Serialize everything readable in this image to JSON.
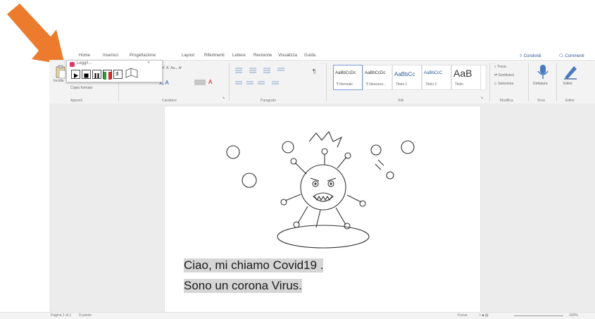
{
  "tabs": [
    {
      "label": "Home"
    },
    {
      "label": "Inserisci"
    },
    {
      "label": "Progettazione"
    },
    {
      "label": "Layout"
    },
    {
      "label": "Riferimenti"
    },
    {
      "label": "Lettere"
    },
    {
      "label": "Revisione"
    },
    {
      "label": "Visualizza"
    },
    {
      "label": "Guida"
    }
  ],
  "share_label": "Condividi",
  "comments_label": "Commenti",
  "clipboard": {
    "paste_label": "Incolla",
    "copy_format_label": "Copia formato",
    "group_label": "Appunti"
  },
  "font": {
    "size_controls": "Aˆ Aˇ  Aa⌄  A̸",
    "group_label": "Carattere"
  },
  "paragraph": {
    "group_label": "Paragrafo"
  },
  "styles": {
    "items": [
      {
        "preview": "AaBbCcDc",
        "name": "¶ Normale"
      },
      {
        "preview": "AaBbCcDc",
        "name": "¶ Nessuna..."
      },
      {
        "preview": "AaBbCc",
        "name": "Titolo 1"
      },
      {
        "preview": "AaBbCcC",
        "name": "Titolo 2"
      },
      {
        "preview": "AaB",
        "name": "Titolo"
      }
    ],
    "group_label": "Stili"
  },
  "editing": {
    "find": "Trova",
    "replace": "Sostituisci",
    "select": "Seleziona",
    "group_label": "Modifica"
  },
  "voice": {
    "dictate": "Dettatura",
    "group_label": "Voce"
  },
  "editor": {
    "label": "Editor",
    "group_label": "Editor"
  },
  "popup": {
    "title": "Leggi!..."
  },
  "document": {
    "lines": [
      "Ciao, mi chiamo Covid19 .",
      "Sono un corona Virus."
    ]
  },
  "status": {
    "page": "Pagina 1 di 1",
    "words": "9 parole",
    "focus": "Focus",
    "zoom": "100%"
  },
  "colors": {
    "arrow": "#ec7b2d",
    "ribbon_bg": "#f3f3f3",
    "workspace_bg": "#ececec",
    "selection": "#d6d6d6",
    "accent": "#2b579a"
  }
}
